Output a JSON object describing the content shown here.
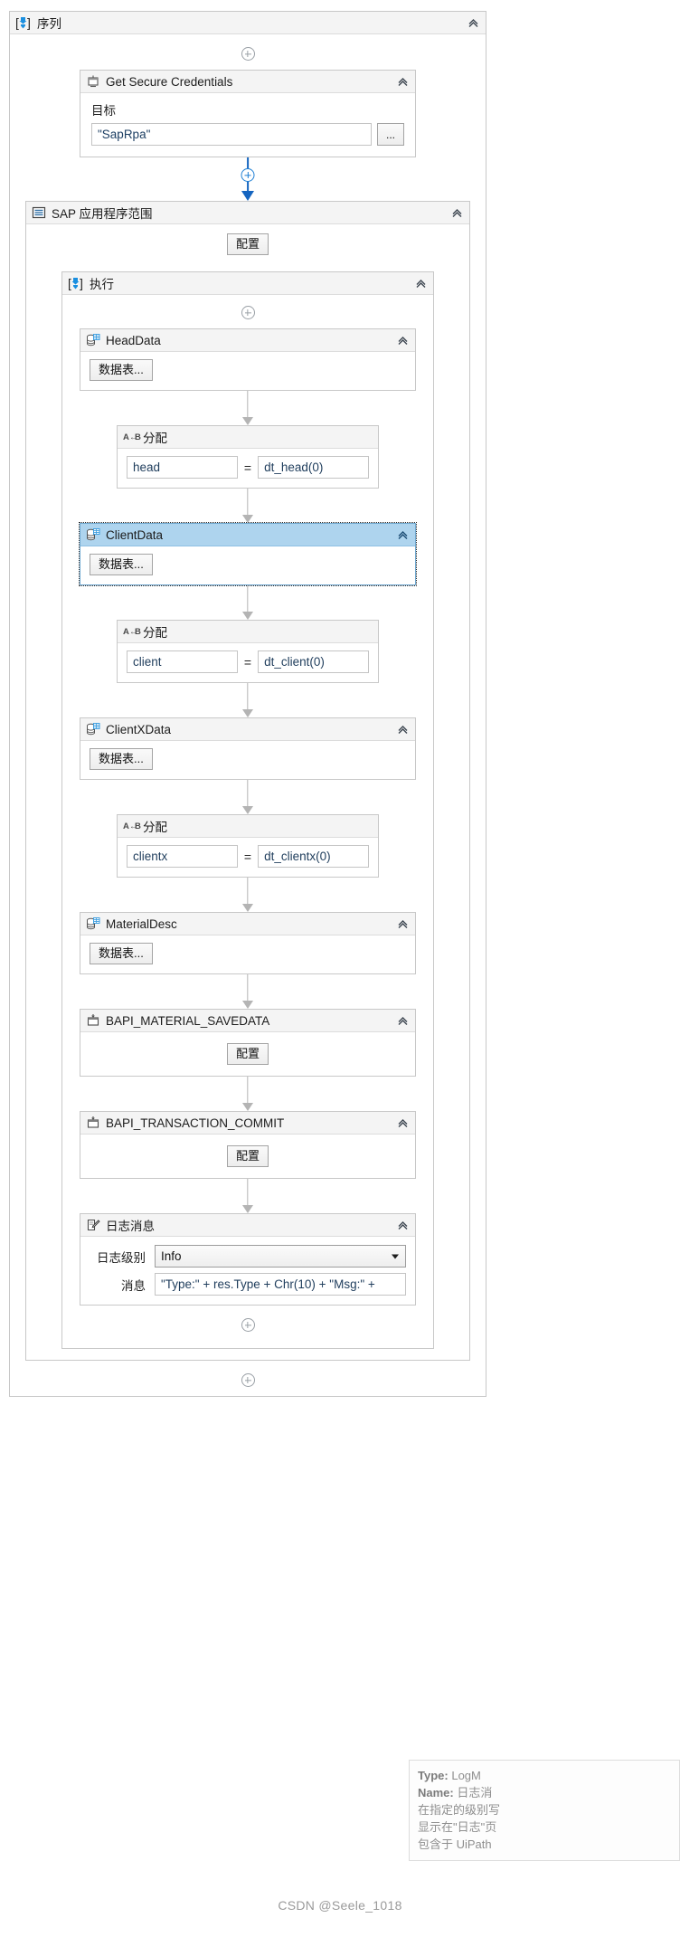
{
  "root": {
    "title": "序列",
    "icon": "sequence-icon"
  },
  "get_credentials": {
    "title": "Get Secure Credentials",
    "icon": "secure-credentials-icon",
    "target_label": "目标",
    "target_value": "\"SapRpa\"",
    "browse_button": "...",
    "collapse_icon": "chevron-up-icon"
  },
  "sap_scope": {
    "title": "SAP 应用程序范围",
    "icon": "sap-scope-icon",
    "configure_button": "配置"
  },
  "execute": {
    "title": "执行",
    "icon": "sequence-icon"
  },
  "activities": [
    {
      "name": "head-data",
      "title": "HeadData",
      "icon": "datatable-icon",
      "kind": "bapi-structure",
      "button": "数据表...",
      "selected": false
    },
    {
      "name": "assign-head",
      "title": "分配",
      "icon": "assign-icon",
      "kind": "assign",
      "left": "head",
      "operator": "=",
      "right": "dt_head(0)"
    },
    {
      "name": "client-data",
      "title": "ClientData",
      "icon": "datatable-icon",
      "kind": "bapi-structure",
      "button": "数据表...",
      "selected": true
    },
    {
      "name": "assign-client",
      "title": "分配",
      "icon": "assign-icon",
      "kind": "assign",
      "left": "client",
      "operator": "=",
      "right": "dt_client(0)"
    },
    {
      "name": "clientx-data",
      "title": "ClientXData",
      "icon": "datatable-icon",
      "kind": "bapi-structure",
      "button": "数据表...",
      "selected": false
    },
    {
      "name": "assign-clientx",
      "title": "分配",
      "icon": "assign-icon",
      "kind": "assign",
      "left": "clientx",
      "operator": "=",
      "right": "dt_clientx(0)"
    },
    {
      "name": "material-desc",
      "title": "MaterialDesc",
      "icon": "datatable-icon",
      "kind": "bapi-structure",
      "button": "数据表...",
      "selected": false
    },
    {
      "name": "bapi-material-savedata",
      "title": "BAPI_MATERIAL_SAVEDATA",
      "icon": "bapi-icon",
      "kind": "bapi-call",
      "button": "配置",
      "selected": false
    },
    {
      "name": "bapi-transaction-commit",
      "title": "BAPI_TRANSACTION_COMMIT",
      "icon": "bapi-icon",
      "kind": "bapi-call",
      "button": "配置",
      "selected": false
    }
  ],
  "log_message": {
    "title": "日志消息",
    "icon": "log-message-icon",
    "level_label": "日志级别",
    "level_value": "Info",
    "message_label": "消息",
    "message_value": "\"Type:\" + res.Type + Chr(10) + \"Msg:\" +"
  },
  "tooltip": {
    "type_label": "Type:",
    "type_value": "LogM",
    "name_label": "Name:",
    "name_value": "日志消",
    "line3": "在指定的级别写",
    "line4": "显示在\"日志\"页",
    "line5": "包含于 UiPath"
  },
  "watermark": "CSDN @Seele_1018"
}
